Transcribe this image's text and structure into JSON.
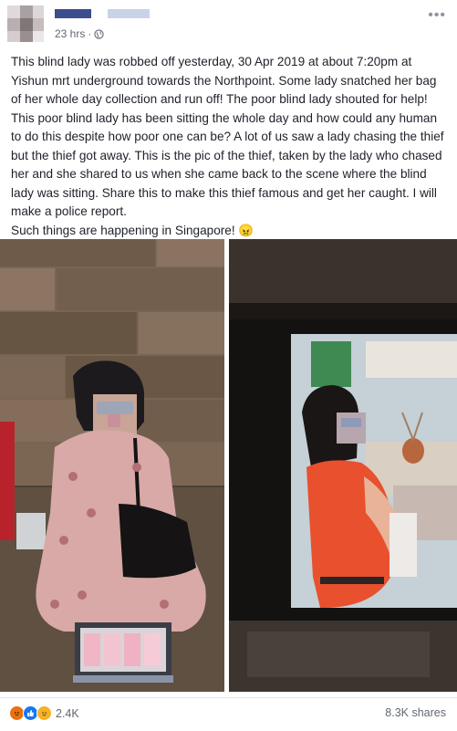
{
  "post": {
    "timestamp": "23 hrs",
    "privacy_icon": "globe-icon",
    "body_text": "This blind lady was robbed off yesterday, 30 Apr 2019 at about 7:20pm at Yishun mrt underground towards the Northpoint. Some lady snatched her bag of her whole day collection and run off! The poor blind lady shouted for help! This poor blind lady has been sitting the whole day and how could any human to do this despite how poor one can be? A lot of us saw a lady chasing the thief but the thief got away. This is the pic of the thief, taken by the lady who chased her and she shared to us when she came back to the scene where the blind lady was sitting. Share this to make this thief famous and get her caught. I will make a police report.\nSuch things are happening in Singapore! 😠"
  },
  "footer": {
    "reaction_icons": [
      "angry-icon",
      "like-icon",
      "sad-icon"
    ],
    "reaction_count": "2.4K",
    "shares": "8.3K shares"
  },
  "colors": {
    "text": "#1d2129",
    "meta": "#616770",
    "like": "#1877f2",
    "angry": "#e9710f",
    "sad": "#f7b125"
  }
}
